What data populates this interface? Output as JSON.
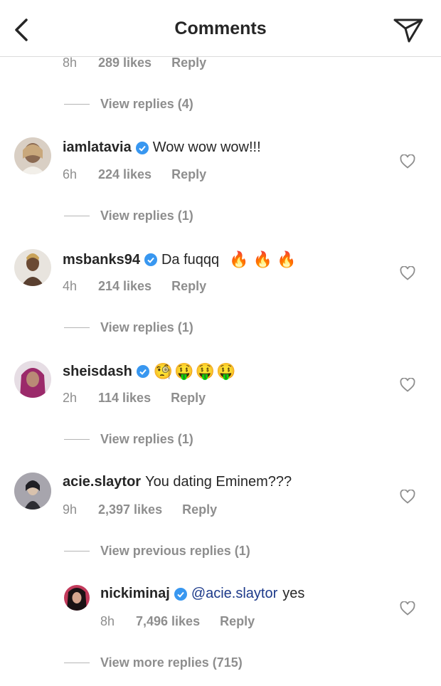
{
  "header": {
    "title": "Comments"
  },
  "top_comment_meta": {
    "time": "8h",
    "likes": "289 likes",
    "reply": "Reply"
  },
  "top_view_replies": "View replies (4)",
  "comments": [
    {
      "username": "iamlatavia",
      "verified": true,
      "text": "Wow wow wow!!!",
      "time": "6h",
      "likes": "224 likes",
      "reply": "Reply",
      "view_replies": "View replies (1)"
    },
    {
      "username": "msbanks94",
      "verified": true,
      "text": "Da fuqqq",
      "emoji": "🔥 🔥 🔥",
      "time": "4h",
      "likes": "214 likes",
      "reply": "Reply",
      "view_replies": "View replies (1)"
    },
    {
      "username": "sheisdash",
      "verified": true,
      "emoji": "🧐🤑🤑🤑",
      "time": "2h",
      "likes": "114 likes",
      "reply": "Reply",
      "view_replies": "View replies (1)"
    },
    {
      "username": "acie.slaytor",
      "verified": false,
      "text": "You dating Eminem???",
      "time": "9h",
      "likes": "2,397 likes",
      "reply": "Reply",
      "view_replies": "View previous replies (1)"
    }
  ],
  "nested_reply": {
    "username": "nickiminaj",
    "verified": true,
    "mention": "@acie.slaytor",
    "text": "yes",
    "time": "8h",
    "likes": "7,496 likes",
    "reply": "Reply"
  },
  "view_more_replies": "View more replies (715)",
  "colors": {
    "verified": "#3897f0",
    "muted": "#8e8e8e",
    "mention": "#1d3a8a"
  }
}
